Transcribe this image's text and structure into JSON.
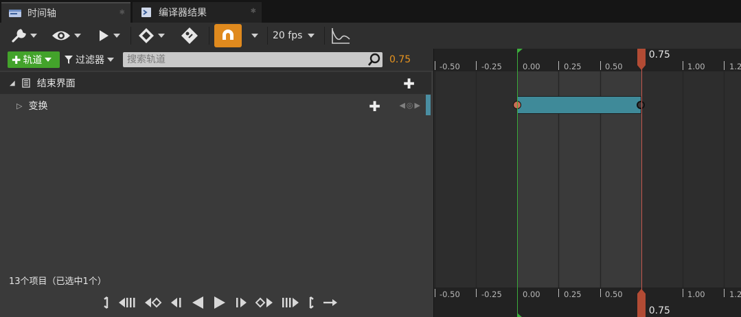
{
  "tabs": [
    {
      "label": "时间轴",
      "active": true
    },
    {
      "label": "编译器结果",
      "active": false
    }
  ],
  "toolbar": {
    "fps_label": "20 fps",
    "accent_color": "#e08a1e"
  },
  "filter": {
    "add_track_label": "轨道",
    "filter_label": "过滤器",
    "search_placeholder": "搜索轨道",
    "current_time": "0.75"
  },
  "tracks": [
    {
      "label": "结束界面"
    },
    {
      "label": "变换"
    }
  ],
  "status": {
    "item_count": "13个项目（已选中1个）"
  },
  "timeline": {
    "tick_labels": [
      "-0.50",
      "-0.25",
      "0.00",
      "0.25",
      "0.50",
      "1.00",
      "1.2"
    ],
    "playhead_time": "0.75",
    "section_start": 0.0,
    "section_end": 0.75,
    "section_color": "#3f8a99"
  }
}
